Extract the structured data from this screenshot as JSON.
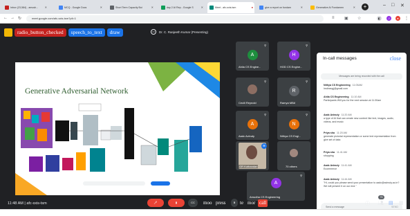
{
  "browser": {
    "tabs": [
      {
        "label": "Inbox (23,584) - amush...",
        "color": "#c5221f"
      },
      {
        "label": "MCQ - Google Docs",
        "color": "#4285f4"
      },
      {
        "label": "Short Term Capacity Bui",
        "color": "#5f6368"
      },
      {
        "label": "day 2 AI Rep - Google S",
        "color": "#0f9d58"
      },
      {
        "label": "Meet - afc-sxis-tsm",
        "color": "#00897b"
      },
      {
        "label": "give a report on fundam",
        "color": "#4285f4"
      },
      {
        "label": "Generative AI Fundamen",
        "color": "#fbbc04"
      }
    ],
    "url": "meet.google.com/afc-sxis-tsm?pli=1"
  },
  "toolbar": {
    "radio_label": "radio_button_checked",
    "speech_label": "speech_to_text",
    "draw_label": "draw",
    "presenter": "Dr. C. Ranjeeth Kumar (Presenting)"
  },
  "slide": {
    "title": "Generative Adversarial Network"
  },
  "participants": [
    {
      "name": "Ahila CS Engine...",
      "initial": "A",
      "color": "#1e8e3e"
    },
    {
      "name": "HOD CS Engine...",
      "initial": "H",
      "color": "#9334e6"
    },
    {
      "name": "Cecili Reynold",
      "initial": "",
      "color": ""
    },
    {
      "name": "Ramya MBA",
      "initial": "R",
      "color": "#5f6368"
    },
    {
      "name": "Aadc Avinuty",
      "initial": "A",
      "color": "#e8710a"
    },
    {
      "name": "Nithya CS Engi...",
      "initial": "N",
      "color": "#e8710a"
    },
    {
      "name": "GR Kothandan",
      "initial": "",
      "color": ""
    },
    {
      "name": "70 others",
      "initial": "",
      "color": ""
    },
    {
      "name": "Amudha CS Engineering",
      "initial": "A",
      "color": "#9334e6"
    }
  ],
  "chat": {
    "title": "In-call messages",
    "close_label": "close",
    "notice": "Messages are being recorded with the call",
    "messages": [
      {
        "sender": "Nithya CS Engineering",
        "time": "11:05AM",
        "text": "Instinsvgj@gmail.com"
      },
      {
        "sender": "Ahila CS Engineering",
        "time": "11:10 AM",
        "text": "Participants Will you for the next session at 11:30am"
      },
      {
        "sender": "Aadc Avinuty",
        "time": "11:20 AM",
        "text": "a type of AI that can create new content like text, images, audio, videos, and music"
      },
      {
        "sender": "Priya sha",
        "time": "11:20 AM",
        "text": "generate pictorial representation or some text representation from give set of data"
      },
      {
        "sender": "Priya sha",
        "time": "11:41 AM",
        "text": "shopping"
      },
      {
        "sender": "Aadc Avinuty",
        "time": "11:41 AM",
        "text": "Ecommerce"
      },
      {
        "sender": "Aadc Avinuty",
        "time": "11:44 AM",
        "text": "\"Hi, could you please send your presentation to aadc@avinuty.ac.in? We will present it on our end.\""
      }
    ],
    "send_placeholder": "Send a message",
    "send_label": "SEND"
  },
  "bottom": {
    "clock": "11:48 AM  |  afc-sxis-tsm",
    "ctrl_pill_1": "moo",
    "ctrl_pill_2": "press",
    "ctrl_pill_3": "te",
    "ctrl_pill_4": "mor",
    "ctrl_pill_5": "call",
    "badge_count": "75"
  },
  "colors": {
    "meet_bg": "#202124",
    "tile_bg": "#3c4043",
    "radio_pill": "#c5221f",
    "speech_pill": "#1a73e8",
    "draw_pill": "#1a73e8",
    "hangup": "#ea4335"
  }
}
